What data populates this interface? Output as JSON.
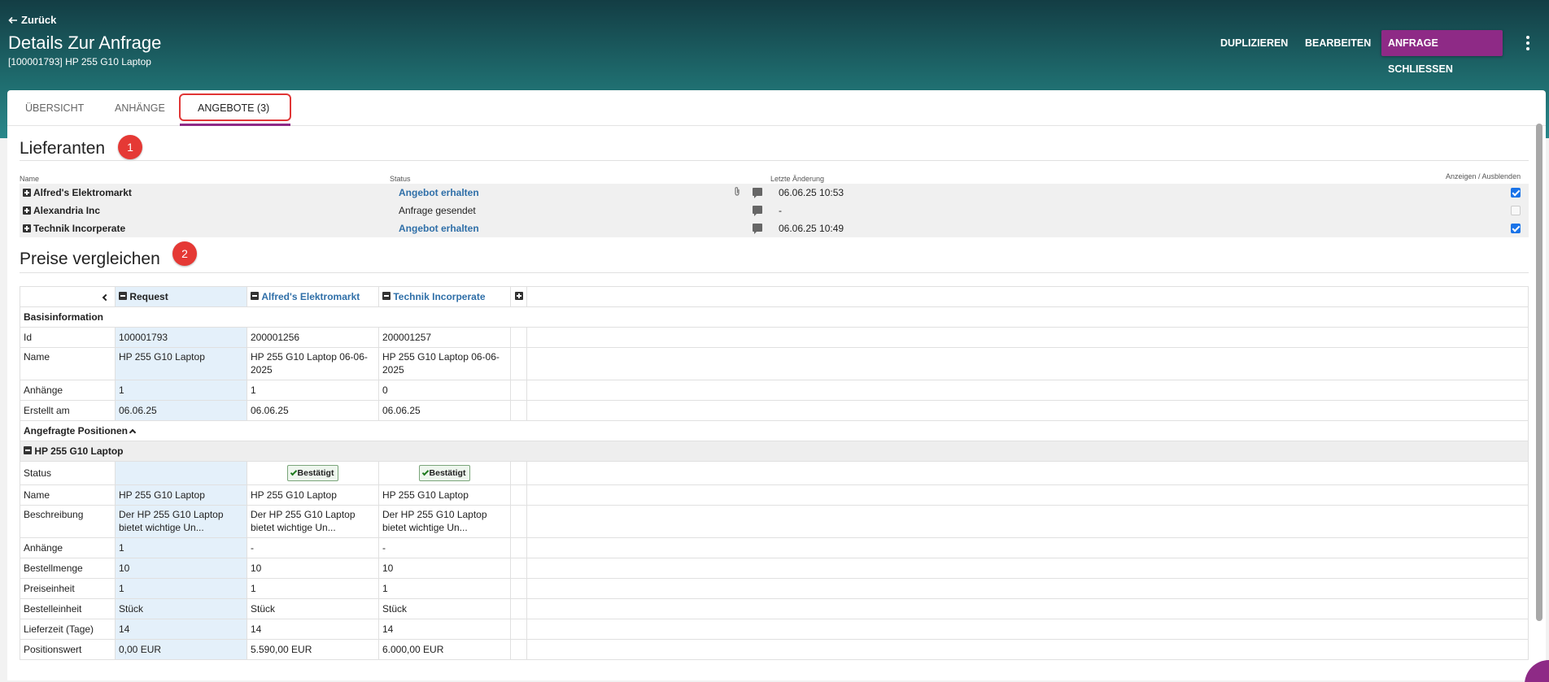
{
  "header": {
    "back_label": "Zurück",
    "title": "Details Zur Anfrage",
    "subtitle": "[100001793] HP 255 G10 Laptop",
    "actions": {
      "duplicate": "DUPLIZIEREN",
      "edit": "BEARBEITEN",
      "close": "ANFRAGE SCHLIESSEN"
    }
  },
  "tabs": [
    {
      "label": "ÜBERSICHT"
    },
    {
      "label": "ANHÄNGE"
    },
    {
      "label": "ANGEBOTE (3)"
    }
  ],
  "annotations": [
    "1",
    "2"
  ],
  "suppliers": {
    "title": "Lieferanten",
    "columns": {
      "name": "Name",
      "status": "Status",
      "last_change": "Letzte Änderung",
      "toggle": "Anzeigen / Ausblenden"
    },
    "rows": [
      {
        "name": "Alfred's Elektromarkt",
        "status": "Angebot erhalten",
        "last_change": "06.06.25 10:53",
        "visible": true
      },
      {
        "name": "Alexandria Inc",
        "status": "Anfrage gesendet",
        "last_change": "-",
        "visible": false
      },
      {
        "name": "Technik Incorperate",
        "status": "Angebot erhalten",
        "last_change": "06.06.25 10:49",
        "visible": true
      }
    ]
  },
  "compare": {
    "title": "Preise vergleichen",
    "columns": {
      "request": "Request",
      "sup1": "Alfred's Elektromarkt",
      "sup2": "Technik Incorperate"
    },
    "sections": {
      "basis": "Basisinformation",
      "positions": "Angefragte Positionen",
      "item": "HP 255 G10 Laptop"
    },
    "basis_rows": [
      {
        "label": "Id",
        "req": "100001793",
        "s1": "200001256",
        "s2": "200001257"
      },
      {
        "label": "Name",
        "req": "HP 255 G10 Laptop",
        "s1": "HP 255 G10 Laptop 06-06-2025",
        "s2": "HP 255 G10 Laptop 06-06-2025"
      },
      {
        "label": "Anhänge",
        "req": "1",
        "s1": "1",
        "s2": "0"
      },
      {
        "label": "Erstellt am",
        "req": "06.06.25",
        "s1": "06.06.25",
        "s2": "06.06.25"
      }
    ],
    "status_row": {
      "label": "Status",
      "s1": "Bestätigt",
      "s2": "Bestätigt"
    },
    "item_rows": [
      {
        "label": "Name",
        "req": "HP 255 G10 Laptop",
        "s1": "HP 255 G10 Laptop",
        "s2": "HP 255 G10 Laptop"
      },
      {
        "label": "Beschreibung",
        "req": "Der HP 255 G10 Laptop bietet wichtige Un...",
        "s1": "Der HP 255 G10 Laptop bietet wichtige Un...",
        "s2": "Der HP 255 G10 Laptop bietet wichtige Un..."
      },
      {
        "label": "Anhänge",
        "req": "1",
        "s1": "-",
        "s2": "-"
      },
      {
        "label": "Bestellmenge",
        "req": "10",
        "s1": "10",
        "s2": "10"
      },
      {
        "label": "Preiseinheit",
        "req": "1",
        "s1": "1",
        "s2": "1"
      },
      {
        "label": "Bestelleinheit",
        "req": "Stück",
        "s1": "Stück",
        "s2": "Stück"
      },
      {
        "label": "Lieferzeit (Tage)",
        "req": "14",
        "s1": "14",
        "s2": "14"
      },
      {
        "label": "Positionswert",
        "req": "0,00 EUR",
        "s1": "5.590,00 EUR",
        "s2": "6.000,00 EUR"
      }
    ]
  },
  "colors": {
    "accent": "#8e2a86",
    "link": "#2f6fa8",
    "request_col": "#e4f0fa",
    "header_dark": "#133d44",
    "header_light": "#29878a"
  }
}
